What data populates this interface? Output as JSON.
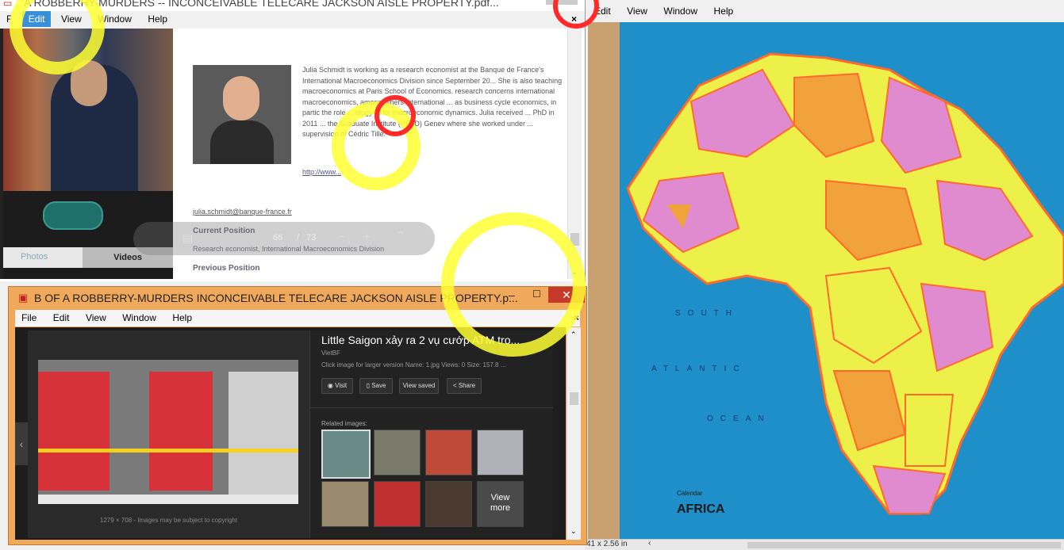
{
  "top_window": {
    "title": "A ROBBERRY-MURDERS -- INCONCEIVABLE TELECARE JACKSON AISLE PROPERTY.pdf...",
    "menu": [
      "F",
      "Edit",
      "View",
      "Window",
      "Help"
    ],
    "close_glyph": "×",
    "video_tabs": [
      "Photos",
      "Videos"
    ],
    "bio_text": "Julia Schmidt is working as a research economist at the Banque de France's International Macroeconomics Division since September 20... She is also teaching macroeconomics at Paris School of Economics. research concerns international macroeconomics, among others international ... as business cycle economics, in partic the role ... ology ... for macroeconomic dynamics. Julia received ... PhD in 2011 ... the Graduate Institute (HEIID) Genev where she worked under ... supervision of Cédric Tille.",
    "link_text": "http://www...",
    "email": "julia.schmidt@banque-france.fr",
    "current_position_label": "Current Position",
    "current_position_text": "Research economist, International Macroeconomics Division",
    "previous_position_label": "Previous Position",
    "page_current": "66",
    "page_sep": "/",
    "page_total": "73"
  },
  "right_window": {
    "menu": [
      "Edit",
      "View",
      "Window",
      "Help"
    ],
    "map_ocean_words": [
      "SOUTH",
      "ATLANTIC",
      "OCEAN"
    ],
    "map_label_small": "Calendar",
    "map_label_big": "AFRICA",
    "status_text": "41 x 2.56 in"
  },
  "bottom_window": {
    "title": "B OF A ROBBERRY-MURDERS INCONCEIVABLE TELECARE JACKSON AISLE PROPERTY.p...",
    "menu": [
      "File",
      "Edit",
      "View",
      "Window",
      "Help"
    ],
    "close_glyph": "×",
    "image_caption": "1279 × 708 - Images may be subject to copyright",
    "result_title": "Little Saigon xảy ra 2 vụ cướp ATM tro...",
    "result_source": "VietBF",
    "result_desc": "Click image for larger version Name: 1.jpg Views: 0 Size: 157.8 ...",
    "buttons": [
      "Visit",
      "Save",
      "View saved",
      "Share"
    ],
    "related_label": "Related images:",
    "view_more": "View more"
  },
  "colors": {
    "taskbar_orange": "#f0a95a",
    "dark_bg": "#222222",
    "map_ocean": "#1f8fc9",
    "map_yellow": "#eef04a",
    "map_orange": "#f2a23a",
    "map_pink": "#e08ad0",
    "highlight_yellow": "#ffff33",
    "highlight_red": "#ff2a2a"
  }
}
